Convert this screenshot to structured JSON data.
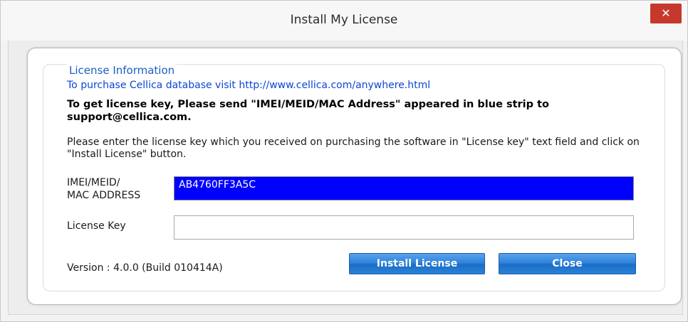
{
  "window": {
    "title": "Install My License",
    "close_glyph": "✕"
  },
  "group": {
    "legend": "License Information",
    "purchase_text": "To purchase Cellica database visit http://www.cellica.com/anywhere.html",
    "instruction_bold": "To get license key, Please send \"IMEI/MEID/MAC Address\" appeared in blue strip to support@cellica.com.",
    "instruction": "Please enter the license key which you received on purchasing the software in \"License key\" text field and click on \"Install License\" button."
  },
  "fields": {
    "imei_label_line1": "IMEI/MEID/",
    "imei_label_line2": "MAC ADDRESS",
    "imei_value": "AB4760FF3A5C",
    "license_key_label": "License Key",
    "license_key_value": ""
  },
  "footer": {
    "version": "Version : 4.0.0 (Build 010414A)",
    "install_label": "Install License",
    "close_label": "Close"
  },
  "colors": {
    "imei_strip": "#0000ff",
    "close_button": "#c7382c",
    "button_blue": "#2f83dc",
    "legend_blue": "#1a5fc0"
  }
}
